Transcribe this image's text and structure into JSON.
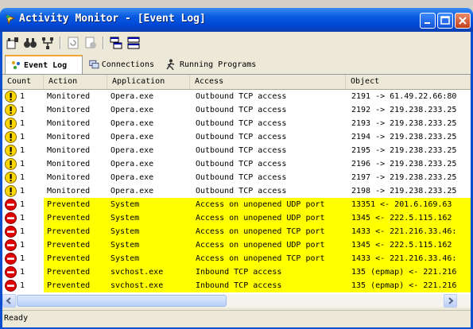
{
  "window": {
    "title": "Activity Monitor - [Event Log]"
  },
  "toolbar": {
    "icons": [
      "properties-icon",
      "find-icon",
      "filter-icon",
      "refresh-icon",
      "clear-icon",
      "tile-horizontal-icon",
      "tile-vertical-icon"
    ]
  },
  "tabs": [
    {
      "label": "Event Log",
      "icon": "event-log-icon",
      "active": true
    },
    {
      "label": "Connections",
      "icon": "connections-icon",
      "active": false
    },
    {
      "label": "Running Programs",
      "icon": "running-programs-icon",
      "active": false
    }
  ],
  "columns": [
    "Count",
    "Action",
    "Application",
    "Access",
    "Object"
  ],
  "rows": [
    {
      "type": "warning",
      "count": "1",
      "action": "Monitored",
      "application": "Opera.exe",
      "access": "Outbound TCP access",
      "object": "2191 -> 61.49.22.66:80"
    },
    {
      "type": "warning",
      "count": "1",
      "action": "Monitored",
      "application": "Opera.exe",
      "access": "Outbound TCP access",
      "object": "2192 -> 219.238.233.25"
    },
    {
      "type": "warning",
      "count": "1",
      "action": "Monitored",
      "application": "Opera.exe",
      "access": "Outbound TCP access",
      "object": "2193 -> 219.238.233.25"
    },
    {
      "type": "warning",
      "count": "1",
      "action": "Monitored",
      "application": "Opera.exe",
      "access": "Outbound TCP access",
      "object": "2194 -> 219.238.233.25"
    },
    {
      "type": "warning",
      "count": "1",
      "action": "Monitored",
      "application": "Opera.exe",
      "access": "Outbound TCP access",
      "object": "2195 -> 219.238.233.25"
    },
    {
      "type": "warning",
      "count": "1",
      "action": "Monitored",
      "application": "Opera.exe",
      "access": "Outbound TCP access",
      "object": "2196 -> 219.238.233.25"
    },
    {
      "type": "warning",
      "count": "1",
      "action": "Monitored",
      "application": "Opera.exe",
      "access": "Outbound TCP access",
      "object": "2197 -> 219.238.233.25"
    },
    {
      "type": "warning",
      "count": "1",
      "action": "Monitored",
      "application": "Opera.exe",
      "access": "Outbound TCP access",
      "object": "2198 -> 219.238.233.25"
    },
    {
      "type": "blocked",
      "count": "1",
      "action": "Prevented",
      "application": "System",
      "access": "Access on unopened UDP port",
      "object": "13351 <- 201.6.169.63"
    },
    {
      "type": "blocked",
      "count": "1",
      "action": "Prevented",
      "application": "System",
      "access": "Access on unopened UDP port",
      "object": "1345 <- 222.5.115.162"
    },
    {
      "type": "blocked",
      "count": "1",
      "action": "Prevented",
      "application": "System",
      "access": "Access on unopened TCP port",
      "object": "1433 <- 221.216.33.46:"
    },
    {
      "type": "blocked",
      "count": "1",
      "action": "Prevented",
      "application": "System",
      "access": "Access on unopened UDP port",
      "object": "1345 <- 222.5.115.162"
    },
    {
      "type": "blocked",
      "count": "1",
      "action": "Prevented",
      "application": "System",
      "access": "Access on unopened TCP port",
      "object": "1433 <- 221.216.33.46:"
    },
    {
      "type": "blocked",
      "count": "1",
      "action": "Prevented",
      "application": "svchost.exe",
      "access": "Inbound TCP access",
      "object": "135 (epmap) <- 221.216"
    },
    {
      "type": "blocked",
      "count": "1",
      "action": "Prevented",
      "application": "svchost.exe",
      "access": "Inbound TCP access",
      "object": "135 (epmap) <- 221.216"
    }
  ],
  "status": {
    "text": "Ready"
  },
  "colors": {
    "highlight": "#ffff00",
    "titlebar": "#0a5ce0"
  }
}
